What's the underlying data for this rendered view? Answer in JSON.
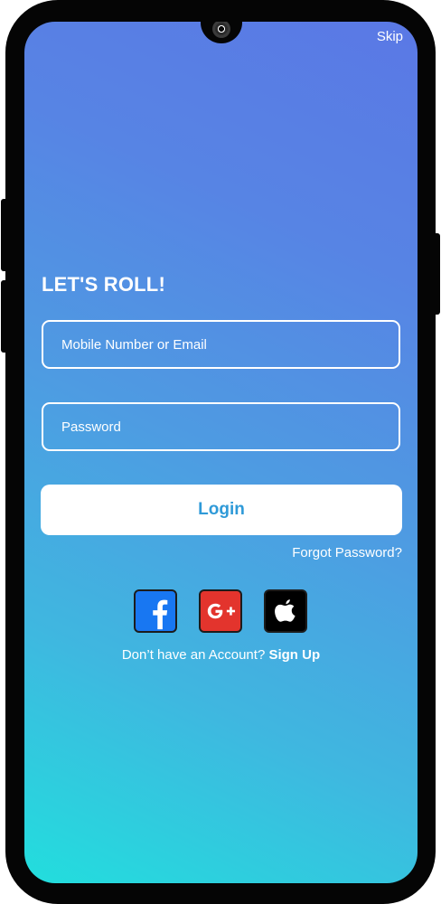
{
  "header": {
    "skip_label": "Skip"
  },
  "login": {
    "title": "LET'S ROLL!",
    "identifier_placeholder": "Mobile Number or Email",
    "password_placeholder": "Password",
    "login_button_label": "Login",
    "forgot_password_label": "Forgot Password?"
  },
  "social": {
    "facebook": {
      "icon": "facebook-icon",
      "glyph": "f",
      "color": "#1877f2"
    },
    "google_plus": {
      "icon": "google-plus-icon",
      "glyph": "G+",
      "color": "#e3342d"
    },
    "apple": {
      "icon": "apple-icon",
      "color": "#000000"
    }
  },
  "footer": {
    "no_account_text": "Don’t have an Account? ",
    "signup_label": "Sign Up"
  }
}
